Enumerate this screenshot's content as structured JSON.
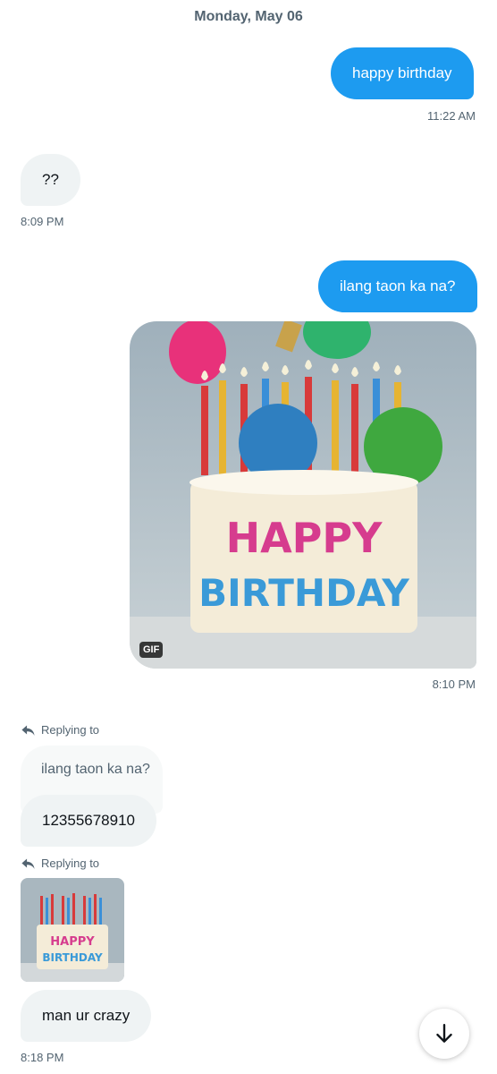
{
  "conversation": {
    "date_header": "Monday, May 06",
    "messages": [
      {
        "side": "out",
        "text": "happy birthday",
        "time": "11:22 AM"
      },
      {
        "side": "in",
        "text": "??",
        "time": "8:09 PM"
      },
      {
        "side": "out",
        "text": "ilang taon ka na?"
      },
      {
        "side": "out",
        "type": "gif",
        "badge": "GIF",
        "cake_text": [
          "HAPPY",
          "BIRTHDAY"
        ],
        "time": "8:10 PM"
      },
      {
        "side": "in",
        "replying_label": "Replying to",
        "quoted_text": "ilang taon ka na?",
        "text": "12355678910"
      },
      {
        "side": "in",
        "replying_label": "Replying to",
        "quoted_type": "gif-thumbnail",
        "cake_text": [
          "HAPPY",
          "BIRTHDAY"
        ],
        "text": "man ur crazy",
        "time": "8:18 PM"
      }
    ]
  },
  "icons": {
    "reply": "reply-arrow-icon",
    "scroll_down": "arrow-down-icon"
  },
  "colors": {
    "accent": "#1d9bf0",
    "incoming_bubble": "#eff3f4",
    "muted_text": "#536471"
  }
}
